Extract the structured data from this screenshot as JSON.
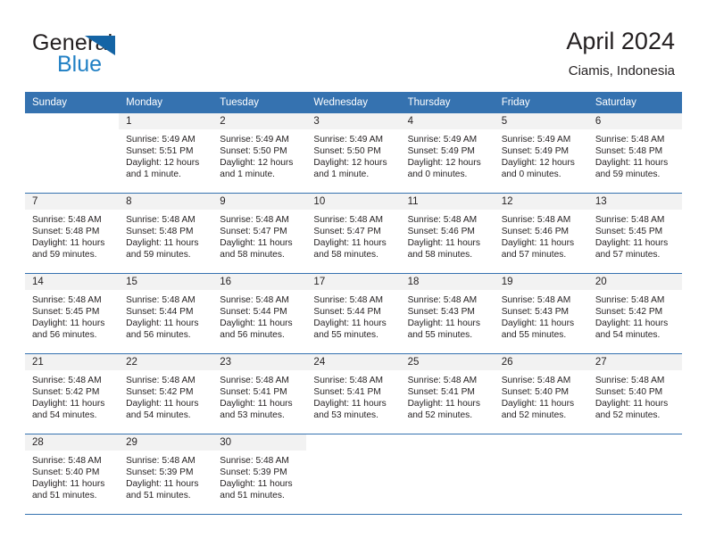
{
  "brand": {
    "name_part1": "General",
    "name_part2": "Blue",
    "accent_color": "#1f7fc4",
    "triangle_color": "#1464a5",
    "triangle_icon": "triangle-logo-icon"
  },
  "header": {
    "title": "April 2024",
    "subtitle": "Ciamis, Indonesia"
  },
  "theme": {
    "header_bar_color": "#3572b0",
    "daynum_band_color": "#f2f2f2",
    "text_color": "#231f20"
  },
  "weekday_headers": [
    "Sunday",
    "Monday",
    "Tuesday",
    "Wednesday",
    "Thursday",
    "Friday",
    "Saturday"
  ],
  "weeks": [
    [
      {
        "blank": true
      },
      {
        "day": "1",
        "sunrise": "Sunrise: 5:49 AM",
        "sunset": "Sunset: 5:51 PM",
        "daylight_line1": "Daylight: 12 hours",
        "daylight_line2": "and 1 minute."
      },
      {
        "day": "2",
        "sunrise": "Sunrise: 5:49 AM",
        "sunset": "Sunset: 5:50 PM",
        "daylight_line1": "Daylight: 12 hours",
        "daylight_line2": "and 1 minute."
      },
      {
        "day": "3",
        "sunrise": "Sunrise: 5:49 AM",
        "sunset": "Sunset: 5:50 PM",
        "daylight_line1": "Daylight: 12 hours",
        "daylight_line2": "and 1 minute."
      },
      {
        "day": "4",
        "sunrise": "Sunrise: 5:49 AM",
        "sunset": "Sunset: 5:49 PM",
        "daylight_line1": "Daylight: 12 hours",
        "daylight_line2": "and 0 minutes."
      },
      {
        "day": "5",
        "sunrise": "Sunrise: 5:49 AM",
        "sunset": "Sunset: 5:49 PM",
        "daylight_line1": "Daylight: 12 hours",
        "daylight_line2": "and 0 minutes."
      },
      {
        "day": "6",
        "sunrise": "Sunrise: 5:48 AM",
        "sunset": "Sunset: 5:48 PM",
        "daylight_line1": "Daylight: 11 hours",
        "daylight_line2": "and 59 minutes."
      }
    ],
    [
      {
        "day": "7",
        "sunrise": "Sunrise: 5:48 AM",
        "sunset": "Sunset: 5:48 PM",
        "daylight_line1": "Daylight: 11 hours",
        "daylight_line2": "and 59 minutes."
      },
      {
        "day": "8",
        "sunrise": "Sunrise: 5:48 AM",
        "sunset": "Sunset: 5:48 PM",
        "daylight_line1": "Daylight: 11 hours",
        "daylight_line2": "and 59 minutes."
      },
      {
        "day": "9",
        "sunrise": "Sunrise: 5:48 AM",
        "sunset": "Sunset: 5:47 PM",
        "daylight_line1": "Daylight: 11 hours",
        "daylight_line2": "and 58 minutes."
      },
      {
        "day": "10",
        "sunrise": "Sunrise: 5:48 AM",
        "sunset": "Sunset: 5:47 PM",
        "daylight_line1": "Daylight: 11 hours",
        "daylight_line2": "and 58 minutes."
      },
      {
        "day": "11",
        "sunrise": "Sunrise: 5:48 AM",
        "sunset": "Sunset: 5:46 PM",
        "daylight_line1": "Daylight: 11 hours",
        "daylight_line2": "and 58 minutes."
      },
      {
        "day": "12",
        "sunrise": "Sunrise: 5:48 AM",
        "sunset": "Sunset: 5:46 PM",
        "daylight_line1": "Daylight: 11 hours",
        "daylight_line2": "and 57 minutes."
      },
      {
        "day": "13",
        "sunrise": "Sunrise: 5:48 AM",
        "sunset": "Sunset: 5:45 PM",
        "daylight_line1": "Daylight: 11 hours",
        "daylight_line2": "and 57 minutes."
      }
    ],
    [
      {
        "day": "14",
        "sunrise": "Sunrise: 5:48 AM",
        "sunset": "Sunset: 5:45 PM",
        "daylight_line1": "Daylight: 11 hours",
        "daylight_line2": "and 56 minutes."
      },
      {
        "day": "15",
        "sunrise": "Sunrise: 5:48 AM",
        "sunset": "Sunset: 5:44 PM",
        "daylight_line1": "Daylight: 11 hours",
        "daylight_line2": "and 56 minutes."
      },
      {
        "day": "16",
        "sunrise": "Sunrise: 5:48 AM",
        "sunset": "Sunset: 5:44 PM",
        "daylight_line1": "Daylight: 11 hours",
        "daylight_line2": "and 56 minutes."
      },
      {
        "day": "17",
        "sunrise": "Sunrise: 5:48 AM",
        "sunset": "Sunset: 5:44 PM",
        "daylight_line1": "Daylight: 11 hours",
        "daylight_line2": "and 55 minutes."
      },
      {
        "day": "18",
        "sunrise": "Sunrise: 5:48 AM",
        "sunset": "Sunset: 5:43 PM",
        "daylight_line1": "Daylight: 11 hours",
        "daylight_line2": "and 55 minutes."
      },
      {
        "day": "19",
        "sunrise": "Sunrise: 5:48 AM",
        "sunset": "Sunset: 5:43 PM",
        "daylight_line1": "Daylight: 11 hours",
        "daylight_line2": "and 55 minutes."
      },
      {
        "day": "20",
        "sunrise": "Sunrise: 5:48 AM",
        "sunset": "Sunset: 5:42 PM",
        "daylight_line1": "Daylight: 11 hours",
        "daylight_line2": "and 54 minutes."
      }
    ],
    [
      {
        "day": "21",
        "sunrise": "Sunrise: 5:48 AM",
        "sunset": "Sunset: 5:42 PM",
        "daylight_line1": "Daylight: 11 hours",
        "daylight_line2": "and 54 minutes."
      },
      {
        "day": "22",
        "sunrise": "Sunrise: 5:48 AM",
        "sunset": "Sunset: 5:42 PM",
        "daylight_line1": "Daylight: 11 hours",
        "daylight_line2": "and 54 minutes."
      },
      {
        "day": "23",
        "sunrise": "Sunrise: 5:48 AM",
        "sunset": "Sunset: 5:41 PM",
        "daylight_line1": "Daylight: 11 hours",
        "daylight_line2": "and 53 minutes."
      },
      {
        "day": "24",
        "sunrise": "Sunrise: 5:48 AM",
        "sunset": "Sunset: 5:41 PM",
        "daylight_line1": "Daylight: 11 hours",
        "daylight_line2": "and 53 minutes."
      },
      {
        "day": "25",
        "sunrise": "Sunrise: 5:48 AM",
        "sunset": "Sunset: 5:41 PM",
        "daylight_line1": "Daylight: 11 hours",
        "daylight_line2": "and 52 minutes."
      },
      {
        "day": "26",
        "sunrise": "Sunrise: 5:48 AM",
        "sunset": "Sunset: 5:40 PM",
        "daylight_line1": "Daylight: 11 hours",
        "daylight_line2": "and 52 minutes."
      },
      {
        "day": "27",
        "sunrise": "Sunrise: 5:48 AM",
        "sunset": "Sunset: 5:40 PM",
        "daylight_line1": "Daylight: 11 hours",
        "daylight_line2": "and 52 minutes."
      }
    ],
    [
      {
        "day": "28",
        "sunrise": "Sunrise: 5:48 AM",
        "sunset": "Sunset: 5:40 PM",
        "daylight_line1": "Daylight: 11 hours",
        "daylight_line2": "and 51 minutes."
      },
      {
        "day": "29",
        "sunrise": "Sunrise: 5:48 AM",
        "sunset": "Sunset: 5:39 PM",
        "daylight_line1": "Daylight: 11 hours",
        "daylight_line2": "and 51 minutes."
      },
      {
        "day": "30",
        "sunrise": "Sunrise: 5:48 AM",
        "sunset": "Sunset: 5:39 PM",
        "daylight_line1": "Daylight: 11 hours",
        "daylight_line2": "and 51 minutes."
      },
      {
        "blank": true
      },
      {
        "blank": true
      },
      {
        "blank": true
      },
      {
        "blank": true
      }
    ]
  ]
}
